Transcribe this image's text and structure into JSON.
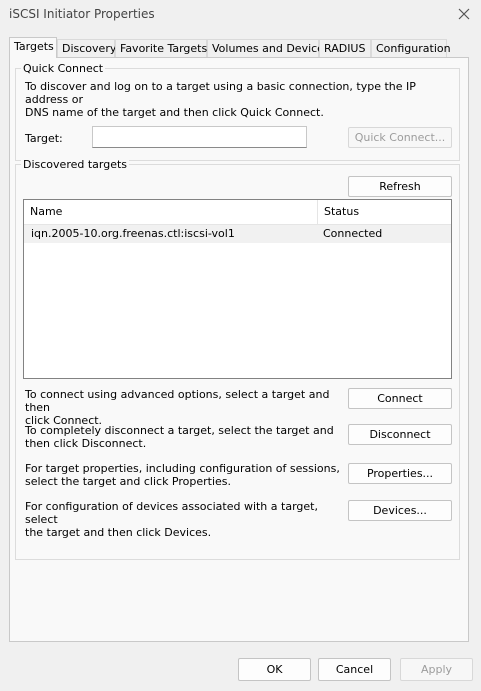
{
  "window": {
    "title": "iSCSI Initiator Properties",
    "close_icon": "close-icon"
  },
  "tabs": [
    {
      "label": "Targets",
      "active": true
    },
    {
      "label": "Discovery"
    },
    {
      "label": "Favorite Targets"
    },
    {
      "label": "Volumes and Devices"
    },
    {
      "label": "RADIUS"
    },
    {
      "label": "Configuration"
    }
  ],
  "quick_connect": {
    "legend": "Quick Connect",
    "description_line1": "To discover and log on to a target using a basic connection, type the IP address or",
    "description_line2": "DNS name of the target and then click Quick Connect.",
    "target_label": "Target:",
    "target_value": "",
    "button_label": "Quick Connect..."
  },
  "discovered": {
    "legend": "Discovered targets",
    "refresh_label": "Refresh",
    "columns": [
      "Name",
      "Status"
    ],
    "rows": [
      {
        "name": "iqn.2005-10.org.freenas.ctl:iscsi-vol1",
        "status": "Connected"
      }
    ]
  },
  "actions": [
    {
      "line1": "To connect using advanced options, select a target and then",
      "line2": "click Connect.",
      "button": "Connect"
    },
    {
      "line1": "To completely disconnect a target, select the target and",
      "line2": "then click Disconnect.",
      "button": "Disconnect"
    },
    {
      "line1": "For target properties, including configuration of sessions,",
      "line2": "select the target and click Properties.",
      "button": "Properties..."
    },
    {
      "line1": "For configuration of devices associated with a target, select",
      "line2": "the target and then click Devices.",
      "button": "Devices..."
    }
  ],
  "footer": {
    "ok": "OK",
    "cancel": "Cancel",
    "apply": "Apply"
  }
}
